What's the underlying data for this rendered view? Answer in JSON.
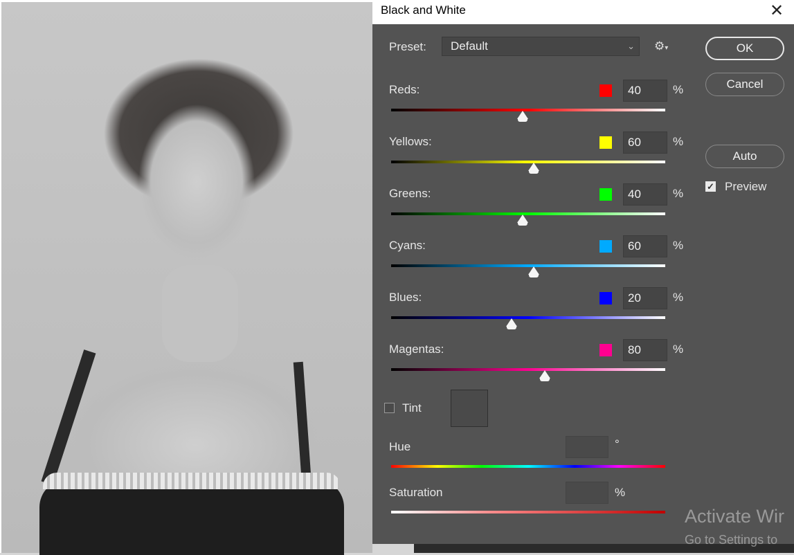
{
  "dialog": {
    "title": "Black and White",
    "close_icon": "close-icon",
    "preset": {
      "label": "Preset:",
      "value": "Default",
      "gear_glyph": "⚙",
      "gear_arrow": "▾"
    },
    "buttons": {
      "ok": "OK",
      "cancel": "Cancel",
      "auto": "Auto"
    },
    "preview": {
      "label": "Preview",
      "checked": true
    },
    "sliders": [
      {
        "label": "Reds:",
        "value": "40",
        "unit": "%",
        "color": "#ff0000",
        "position": 0.48
      },
      {
        "label": "Yellows:",
        "value": "60",
        "unit": "%",
        "color": "#ffff00",
        "position": 0.52
      },
      {
        "label": "Greens:",
        "value": "40",
        "unit": "%",
        "color": "#00ff00",
        "position": 0.48
      },
      {
        "label": "Cyans:",
        "value": "60",
        "unit": "%",
        "color": "#00aaff",
        "position": 0.52
      },
      {
        "label": "Blues:",
        "value": "20",
        "unit": "%",
        "color": "#0000ff",
        "position": 0.44
      },
      {
        "label": "Magentas:",
        "value": "80",
        "unit": "%",
        "color": "#ff0090",
        "position": 0.56
      }
    ],
    "tint": {
      "label": "Tint",
      "checked": false
    },
    "hue": {
      "label": "Hue",
      "unit": "°"
    },
    "saturation": {
      "label": "Saturation",
      "unit": "%"
    }
  },
  "watermark": {
    "line1": "Activate Wir",
    "line2": "Go to Settings to"
  }
}
